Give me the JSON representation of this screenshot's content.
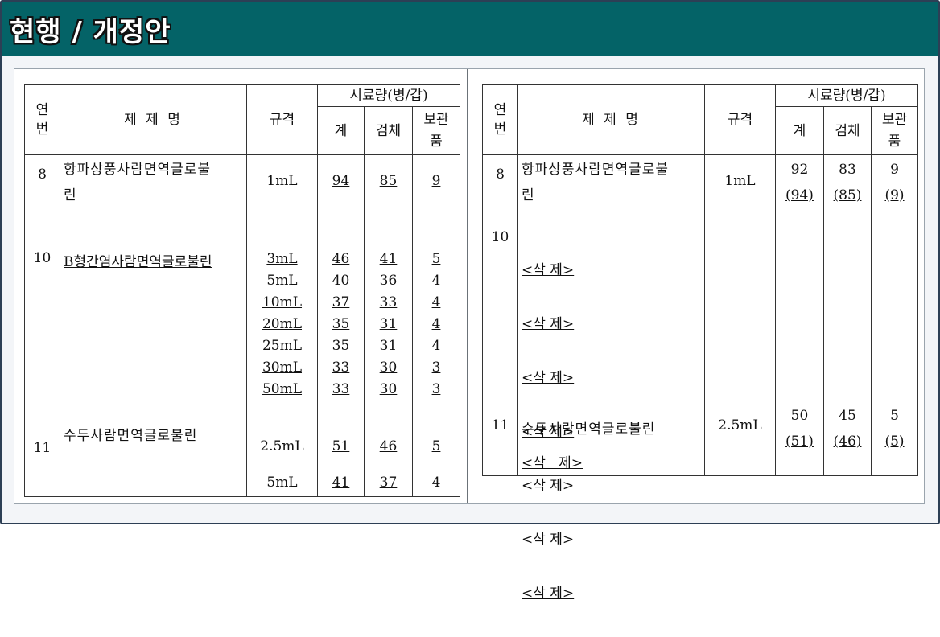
{
  "header": {
    "title": "현행 / 개정안"
  },
  "columns": {
    "no_a": "연",
    "no_b": "번",
    "name": "제 제 명",
    "spec": "규격",
    "sample_group": "시료량(병/갑)",
    "total": "계",
    "test": "검체",
    "keep_a": "보관",
    "keep_b": "품"
  },
  "current": {
    "rows": [
      {
        "no": "8",
        "name_lines": [
          "항파상풍사람면역글로불",
          "린"
        ],
        "specs": [
          "1mL"
        ],
        "totals": [
          "94"
        ],
        "tests": [
          "85"
        ],
        "keeps": [
          "9"
        ]
      },
      {
        "no": "10",
        "name_lines": [
          "B형간염사람면역글로불린"
        ],
        "specs": [
          "3mL",
          "5mL",
          "10mL",
          "20mL",
          "25mL",
          "30mL",
          "50mL"
        ],
        "totals": [
          "46",
          "40",
          "37",
          "35",
          "35",
          "33",
          "33"
        ],
        "tests": [
          "41",
          "36",
          "33",
          "31",
          "31",
          "30",
          "30"
        ],
        "keeps": [
          "5",
          "4",
          "4",
          "4",
          "4",
          "3",
          "3"
        ]
      },
      {
        "no": "11",
        "name_lines": [
          "수두사람면역글로불린"
        ],
        "specs": [
          "2.5mL",
          "5mL"
        ],
        "totals": [
          "51",
          "41"
        ],
        "tests": [
          "46",
          "37"
        ],
        "keeps": [
          "5",
          "4"
        ]
      }
    ]
  },
  "revised": {
    "rows": [
      {
        "no": "8",
        "name_lines": [
          "항파상풍사람면역글로불",
          "린"
        ],
        "spec": "1mL",
        "total": [
          "92",
          "(94)"
        ],
        "test": [
          "83",
          "(85)"
        ],
        "keep": [
          "9",
          "(9)"
        ]
      },
      {
        "no": "10",
        "deleted": [
          "<삭   제>",
          "<삭   제>",
          "<삭   제>",
          "<삭   제>",
          "<삭   제>",
          "<삭   제>",
          "<삭   제>"
        ]
      },
      {
        "no": "11",
        "name_lines": [
          "수두사람면역글로불린"
        ],
        "deleted": "<삭   제>",
        "spec": "2.5mL",
        "total": [
          "50",
          "(51)"
        ],
        "test": [
          "45",
          "(46)"
        ],
        "keep": [
          "5",
          "(5)"
        ]
      }
    ]
  }
}
